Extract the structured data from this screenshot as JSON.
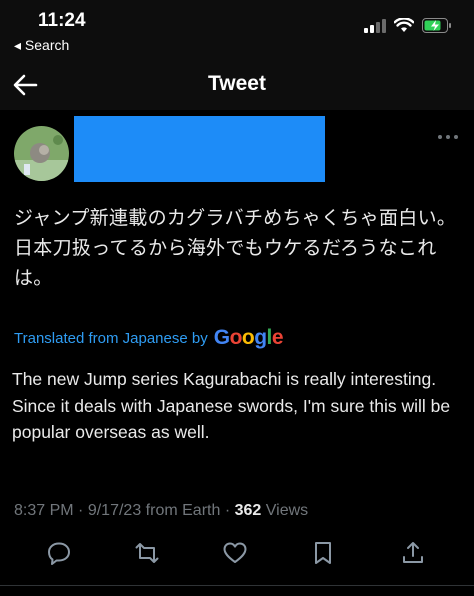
{
  "status_bar": {
    "time": "11:24",
    "back_app": "Search",
    "icons": [
      "cellular-signal-icon",
      "wifi-icon",
      "battery-charging-icon"
    ]
  },
  "nav": {
    "title": "Tweet",
    "back_icon": "arrow-left-icon"
  },
  "tweet": {
    "text_ja": "ジャンプ新連載のカグラバチめちゃくちゃ面白い。日本刀扱ってるから海外でもウケるだろうなこれは。",
    "translated_label": "Translated from Japanese by",
    "translator": "Google",
    "translation_line1": "The new Jump series Kagurabachi is really interesting.",
    "translation_line2": "Since it deals with Japanese swords, I'm sure this will be popular overseas as well.",
    "time": "8:37 PM",
    "date": "9/17/23",
    "source": "from Earth",
    "views_count": "362",
    "views_label": "Views"
  },
  "colors": {
    "background": "#000000",
    "link": "#2f9cf2",
    "redaction": "#1d8cf8",
    "muted": "#71767b"
  },
  "actions": [
    "reply-icon",
    "retweet-icon",
    "like-icon",
    "bookmark-icon",
    "share-icon"
  ]
}
